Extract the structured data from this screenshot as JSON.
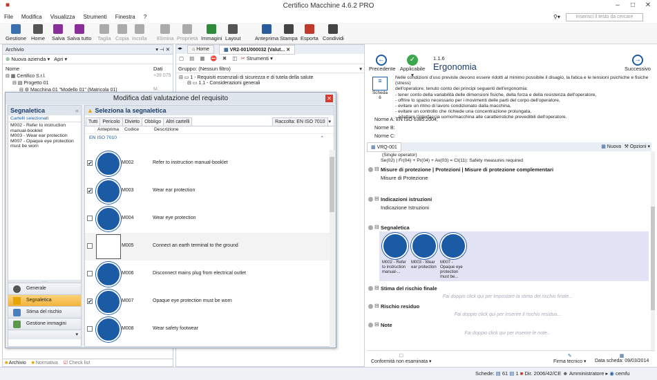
{
  "window": {
    "title": "Certifico Macchine 4.6.2 PRO"
  },
  "menu": [
    "File",
    "Modifica",
    "Visualizza",
    "Strumenti",
    "Finestra",
    "?"
  ],
  "search": {
    "placeholder": "Inserisci il testo da cercare"
  },
  "toolbar": [
    {
      "label": "Gestione",
      "color": "#3a6fb0"
    },
    {
      "label": "Home",
      "color": "#555"
    },
    {
      "label": "Salva",
      "color": "#8a2e9a"
    },
    {
      "label": "Salva tutto",
      "color": "#8a2e9a"
    },
    {
      "label": "Taglia",
      "color": "#aaa"
    },
    {
      "label": "Copia",
      "color": "#aaa"
    },
    {
      "label": "Incolla",
      "color": "#aaa"
    },
    {
      "label": "Elimina",
      "color": "#aaa"
    },
    {
      "label": "Proprietà",
      "color": "#aaa"
    },
    {
      "label": "Immagini",
      "color": "#2f8a3c"
    },
    {
      "label": "Layout",
      "color": "#555"
    },
    {
      "label": "Anteprima",
      "color": "#2a5b9a"
    },
    {
      "label": "Stampa",
      "color": "#444"
    },
    {
      "label": "Esporta",
      "color": "#c0392b"
    },
    {
      "label": "Condividi",
      "color": "#444"
    }
  ],
  "archivio": {
    "title": "Archivio",
    "new_company": "Nuova azienda",
    "open": "Apri",
    "col_name": "Nome",
    "col_data": "Dati",
    "tree": [
      {
        "label": "Certifico S.r.l.",
        "data": "+39 075"
      },
      {
        "label": "Progetto 01",
        "data": ""
      },
      {
        "label": "Macchina 01 \"Modello 01\" (Matricola 01)",
        "data": "M.. Macc"
      }
    ],
    "bottom_tabs": [
      "Archivio",
      "Normativa",
      "Check list"
    ]
  },
  "doc_tabs": {
    "home": "Home",
    "doc": "VR2-001/000032 (Valut..."
  },
  "doc_toolbar": {
    "strumenti": "Strumenti"
  },
  "group": {
    "label": "Gruppo:",
    "value": "(Nessun filtro)"
  },
  "req_tree": [
    {
      "label": "1 - Requisiti essenziali di sicurezza e di tutela della salute"
    },
    {
      "label": "1.1 - Considerazioni generali"
    }
  ],
  "dialog": {
    "title": "Modifica dati valutazione del requisito",
    "left_title": "Segnaletica",
    "selected_header": "Cartelli selezionati",
    "selected": [
      "M002 - Refer to instruction manual-booklet",
      "M003 - Wear ear protection",
      "M007 - Opaque eye protection must be worn"
    ],
    "nav": [
      {
        "label": "Generale",
        "color": "#555"
      },
      {
        "label": "Segnaletica",
        "color": "#e8a400"
      },
      {
        "label": "Stima del rischio",
        "color": "#4a7fc1"
      },
      {
        "label": "Gestione immagini",
        "color": "#5a9a4a"
      }
    ],
    "select_title": "Seleziona la segnaletica",
    "tabs": [
      "Tutti",
      "Pericolo",
      "Divieto",
      "Obbligo",
      "Altri cartelli"
    ],
    "raccolta": "Raccolta: EN ISO 7010",
    "cols": {
      "preview": "Anteprima",
      "code": "Codice",
      "desc": "Descrizione"
    },
    "group": "EN ISO 7010",
    "rows": [
      {
        "code": "M002",
        "desc": "Refer to instruction manual-booklet",
        "checked": "✔",
        "icon": "manual-sign-icon"
      },
      {
        "code": "M003",
        "desc": "Wear ear protection",
        "checked": "✔",
        "icon": "ear-protection-sign-icon"
      },
      {
        "code": "M004",
        "desc": "Wear eye protection",
        "checked": "",
        "icon": "eye-protection-sign-icon"
      },
      {
        "code": "M005",
        "desc": "Connect an earth terminal to the ground",
        "checked": "",
        "icon": "earth-terminal-sign-icon"
      },
      {
        "code": "M006",
        "desc": "Disconnect mains plug from electrical outlet",
        "checked": "",
        "icon": "unplug-sign-icon"
      },
      {
        "code": "M007",
        "desc": "Opaque eye protection must be worn",
        "checked": "✔",
        "icon": "opaque-eye-sign-icon"
      },
      {
        "code": "M008",
        "desc": "Wear safety footwear",
        "checked": "",
        "icon": "footwear-sign-icon"
      }
    ]
  },
  "right": {
    "prev": "Precedente",
    "applicable": "Applicabile",
    "code": "1.1.6",
    "title": "Ergonomia",
    "next": "Successivo",
    "scheda": "Scheda",
    "scheda_n": "6",
    "text": [
      "Nelle condizioni d'uso previste devono essere ridotti al minimo possibile il disagio, la fatica e le tensioni psichiche e fisiche (stress)",
      "dell'operatore, tenuto conto dei principi seguenti dell'ergonomia:",
      "- tener conto della variabilità delle dimensioni fisiche, della forza e della resistenza dell'operatore,",
      "- offrire lo spazio necessario per i movimenti delle parti del corpo dell'operatore,",
      "- evitare un ritmo di lavoro condizionato dalla macchina,",
      "- evitare un controllo che richiede una concentrazione prolungata,",
      "- adattare l'interfaccia uomo/macchina alle caratteristiche prevedibili dell'operatore."
    ],
    "norme": [
      {
        "label": "Norme A:",
        "value": "EN ISO 6385:2004;"
      },
      {
        "label": "Norme B:",
        "value": ""
      },
      {
        "label": "Norme C:",
        "value": ""
      }
    ],
    "vrq_tab": "VRQ-001",
    "nuova": "Nuova",
    "opzioni": "Opzioni",
    "formula1": "(Single operator)",
    "formula2": "Se(02) | Fr(04) + Pr(04) + Av(03) = CI(11): Safety measures required",
    "misure_h": "Misure di protezione | Protezioni | Misure di protezione complementari",
    "misure_v": "Misure di Protezione",
    "istr_h": "Indicazioni istruzioni",
    "istr_v": "Indicazione Istruzioni",
    "seg_h": "Segnaletica",
    "signs": [
      {
        "label": "M002 - Refer to instruction manual-..."
      },
      {
        "label": "M003 - Wear ear protection"
      },
      {
        "label": "M007 - Opaque eye protection must be..."
      }
    ],
    "stima_h": "Stima del rischio finale",
    "stima_ph": "Fai doppio click qui per impostare la stima del rischio finale...",
    "res_h": "Rischio residuo",
    "res_ph": "Fai doppio click qui per inserire il rischio residuo...",
    "note_h": "Note",
    "note_ph": "Fai doppio click qui per inserire le note...",
    "conf": "Conformità non esaminata",
    "firma": "Firma tecnico",
    "data_scheda": "Data scheda: 09/03/2014"
  },
  "status": {
    "schede": "Schede:",
    "n1": "61",
    "n2": "1",
    "dir": "Dir. 2006/42/CE",
    "admin": "Amministratore",
    "user": "cemfu"
  }
}
